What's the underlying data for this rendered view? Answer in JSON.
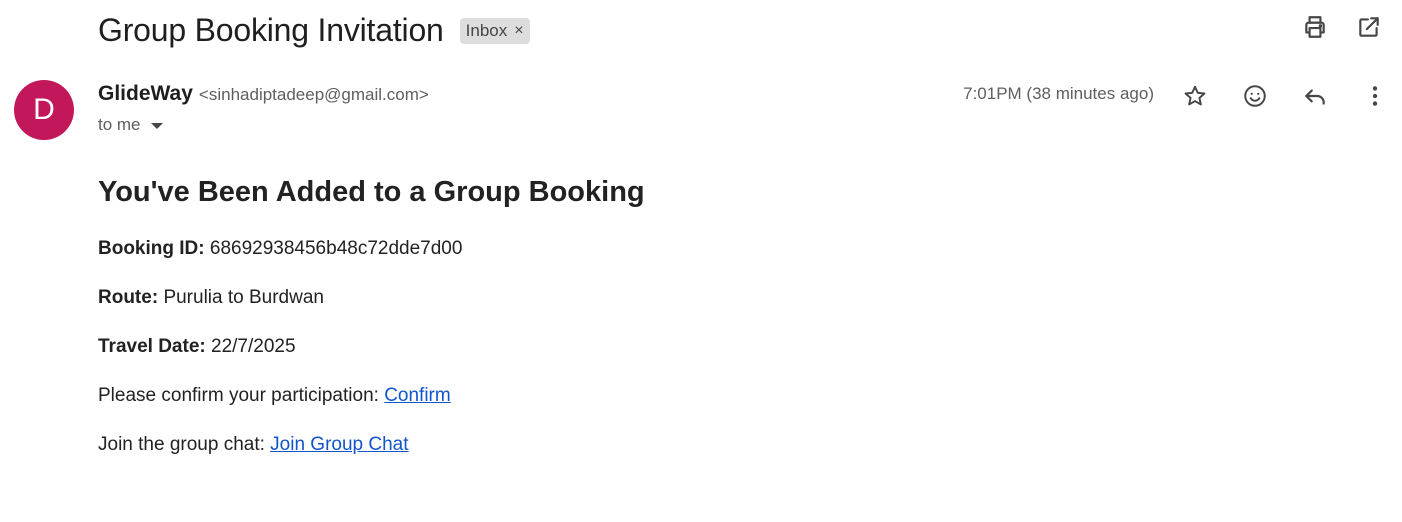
{
  "subject": "Group Booking Invitation",
  "label_chip": {
    "text": "Inbox",
    "remove_glyph": "×"
  },
  "toolbar": {
    "print_icon": "print-icon",
    "open_new_window_icon": "open-in-new-icon"
  },
  "sender": {
    "avatar_letter": "D",
    "avatar_color": "#c2185b",
    "name": "GlideWay",
    "email": "<sinhadiptadeep@gmail.com>",
    "to_text": "to me"
  },
  "time": "7:01PM (38 minutes ago)",
  "actions": {
    "star_icon": "star-icon",
    "emoji_icon": "emoji-reaction-icon",
    "reply_icon": "reply-icon",
    "more_icon": "more-vert-icon"
  },
  "body": {
    "heading": "You've Been Added to a Group Booking",
    "booking_id_label": "Booking ID:",
    "booking_id_value": "68692938456b48c72dde7d00",
    "route_label": "Route:",
    "route_value": "Purulia to Burdwan",
    "travel_date_label": "Travel Date:",
    "travel_date_value": "22/7/2025",
    "confirm_text": "Please confirm your participation:",
    "confirm_link": "Confirm",
    "chat_text": "Join the group chat:",
    "chat_link": "Join Group Chat"
  },
  "colors": {
    "link": "#1155cc",
    "chip_bg": "#dddddd"
  }
}
